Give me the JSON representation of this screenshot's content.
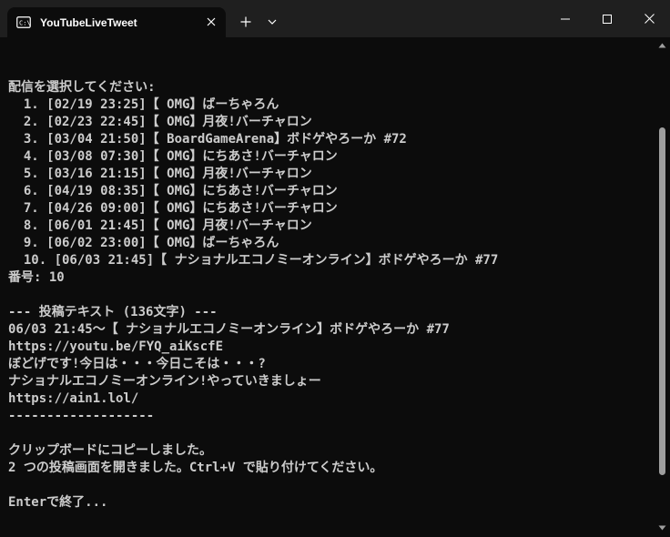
{
  "tab": {
    "title": "YouTubeLiveTweet",
    "icon": "terminal-icon"
  },
  "terminal_lines": [
    "",
    "配信を選択してください:",
    "  1. [02/19 23:25]【 OMG】ばーちゃろん",
    "  2. [02/23 22:45]【 OMG】月夜!バーチャロン",
    "  3. [03/04 21:50]【 BoardGameArena】ボドゲやろーか #72",
    "  4. [03/08 07:30]【 OMG】にちあさ!バーチャロン",
    "  5. [03/16 21:15]【 OMG】月夜!バーチャロン",
    "  6. [04/19 08:35]【 OMG】にちあさ!バーチャロン",
    "  7. [04/26 09:00]【 OMG】にちあさ!バーチャロン",
    "  8. [06/01 21:45]【 OMG】月夜!バーチャロン",
    "  9. [06/02 23:00]【 OMG】ばーちゃろん",
    "  10. [06/03 21:45]【 ナショナルエコノミーオンライン】ボドゲやろーか #77",
    "番号: 10",
    "",
    "--- 投稿テキスト (136文字) ---",
    "06/03 21:45〜【 ナショナルエコノミーオンライン】ボドゲやろーか #77",
    "https://youtu.be/FYQ_aiKscfE",
    "ぼどげです!今日は・・・今日こそは・・・?",
    "ナショナルエコノミーオンライン!やっていきましょー",
    "https://ain1.lol/",
    "-------------------",
    "",
    "クリップボードにコピーしました。",
    "2 つの投稿画面を開きました。Ctrl+V で貼り付けてください。",
    "",
    "Enterで終了..."
  ],
  "colors": {
    "titlebar": "#1f1f1f",
    "background": "#0c0c0c",
    "text": "#cccccc",
    "scroll_thumb": "#9e9e9e"
  }
}
